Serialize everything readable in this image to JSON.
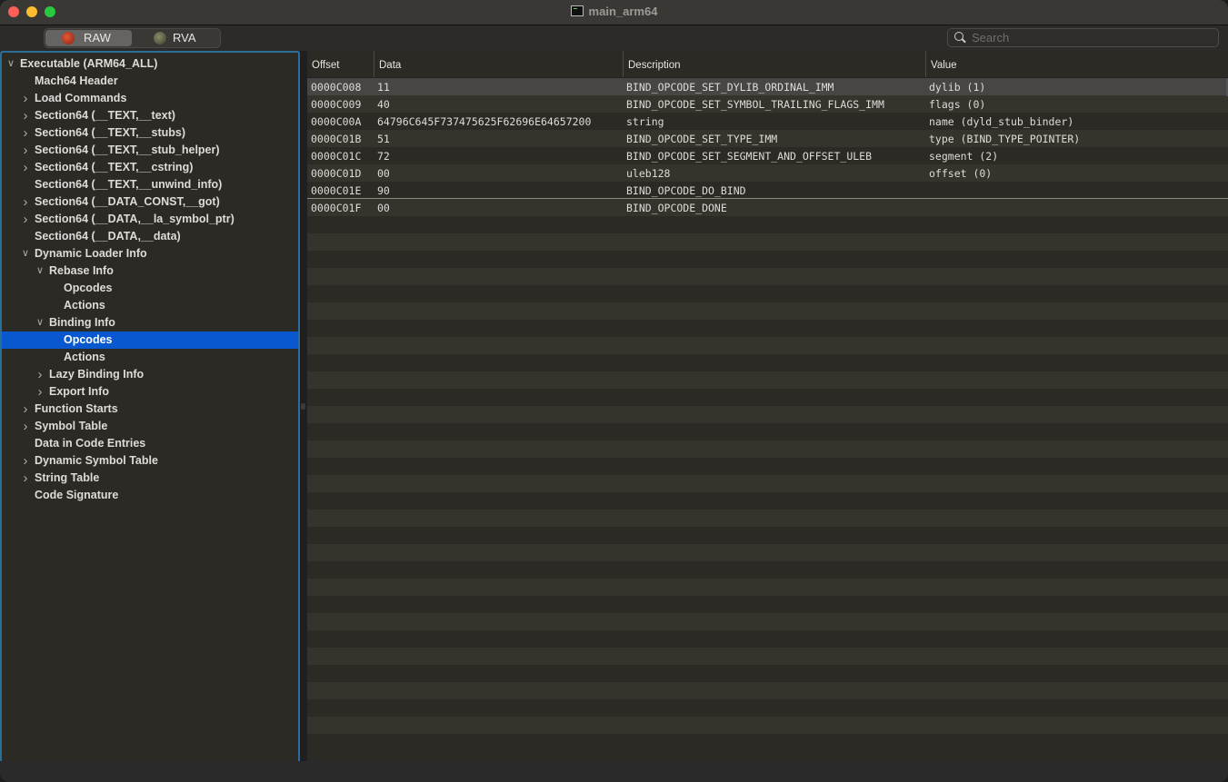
{
  "window": {
    "title": "main_arm64",
    "title_icon": "terminal-icon"
  },
  "toolbar": {
    "segments": [
      {
        "label": "RAW",
        "icon": "red-apple-icon",
        "selected": true
      },
      {
        "label": "RVA",
        "icon": "green-apple-icon",
        "selected": false
      }
    ],
    "search": {
      "placeholder": "Search",
      "value": ""
    }
  },
  "sidebar": {
    "items": [
      {
        "label": "Executable  (ARM64_ALL)",
        "level": 0,
        "chevron": "down"
      },
      {
        "label": "Mach64 Header",
        "level": 1,
        "chevron": "none"
      },
      {
        "label": "Load Commands",
        "level": 1,
        "chevron": "right"
      },
      {
        "label": "Section64 (__TEXT,__text)",
        "level": 1,
        "chevron": "right"
      },
      {
        "label": "Section64 (__TEXT,__stubs)",
        "level": 1,
        "chevron": "right"
      },
      {
        "label": "Section64 (__TEXT,__stub_helper)",
        "level": 1,
        "chevron": "right"
      },
      {
        "label": "Section64 (__TEXT,__cstring)",
        "level": 1,
        "chevron": "right"
      },
      {
        "label": "Section64 (__TEXT,__unwind_info)",
        "level": 1,
        "chevron": "none"
      },
      {
        "label": "Section64 (__DATA_CONST,__got)",
        "level": 1,
        "chevron": "right"
      },
      {
        "label": "Section64 (__DATA,__la_symbol_ptr)",
        "level": 1,
        "chevron": "right"
      },
      {
        "label": "Section64 (__DATA,__data)",
        "level": 1,
        "chevron": "none"
      },
      {
        "label": "Dynamic Loader Info",
        "level": 1,
        "chevron": "down"
      },
      {
        "label": "Rebase Info",
        "level": 2,
        "chevron": "down"
      },
      {
        "label": "Opcodes",
        "level": 3,
        "chevron": "none"
      },
      {
        "label": "Actions",
        "level": 3,
        "chevron": "none"
      },
      {
        "label": "Binding Info",
        "level": 2,
        "chevron": "down"
      },
      {
        "label": "Opcodes",
        "level": 3,
        "chevron": "none",
        "selected": true
      },
      {
        "label": "Actions",
        "level": 3,
        "chevron": "none"
      },
      {
        "label": "Lazy Binding Info",
        "level": 2,
        "chevron": "right"
      },
      {
        "label": "Export Info",
        "level": 2,
        "chevron": "right"
      },
      {
        "label": "Function Starts",
        "level": 1,
        "chevron": "right"
      },
      {
        "label": "Symbol Table",
        "level": 1,
        "chevron": "right"
      },
      {
        "label": "Data in Code Entries",
        "level": 1,
        "chevron": "none"
      },
      {
        "label": "Dynamic Symbol Table",
        "level": 1,
        "chevron": "right"
      },
      {
        "label": "String Table",
        "level": 1,
        "chevron": "right"
      },
      {
        "label": "Code Signature",
        "level": 1,
        "chevron": "none"
      }
    ]
  },
  "table": {
    "columns": [
      "Offset",
      "Data",
      "Description",
      "Value"
    ],
    "rows": [
      {
        "offset": "0000C008",
        "data": "11",
        "description": "BIND_OPCODE_SET_DYLIB_ORDINAL_IMM",
        "value": "dylib (1)",
        "selected": true
      },
      {
        "offset": "0000C009",
        "data": "40",
        "description": "BIND_OPCODE_SET_SYMBOL_TRAILING_FLAGS_IMM",
        "value": "flags (0)"
      },
      {
        "offset": "0000C00A",
        "data": "64796C645F737475625F62696E64657200",
        "description": "string",
        "value": "name (dyld_stub_binder)"
      },
      {
        "offset": "0000C01B",
        "data": "51",
        "description": "BIND_OPCODE_SET_TYPE_IMM",
        "value": "type (BIND_TYPE_POINTER)"
      },
      {
        "offset": "0000C01C",
        "data": "72",
        "description": "BIND_OPCODE_SET_SEGMENT_AND_OFFSET_ULEB",
        "value": "segment (2)"
      },
      {
        "offset": "0000C01D",
        "data": "00",
        "description": "uleb128",
        "value": "offset (0)"
      },
      {
        "offset": "0000C01E",
        "data": "90",
        "description": "BIND_OPCODE_DO_BIND",
        "value": "",
        "underline": true
      },
      {
        "offset": "0000C01F",
        "data": "00",
        "description": "BIND_OPCODE_DONE",
        "value": ""
      }
    ]
  },
  "colors": {
    "selection": "#0a58d0",
    "sidebar_focus_ring": "#2b6d99"
  }
}
